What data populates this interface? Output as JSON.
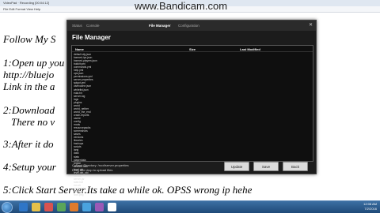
{
  "recorder": {
    "watermark": "www.Bandicam.com"
  },
  "notepad": {
    "title": "VideoPad · Recording [00:04:12]",
    "menu": "File  Edit  Format  View  Help",
    "lines": [
      "Follow My S",
      "1:Open up you",
      "http://bluejo",
      "Link in the a",
      "2:Download",
      "There no v",
      "3:After it do",
      "4:Setup your",
      "5:Click Start Server.Its take a while ok. OPSS wrong ip hehe"
    ]
  },
  "file_manager": {
    "tabs": [
      "Status",
      "Console",
      "File Manager",
      "Configuration"
    ],
    "active_tab": "File Manager",
    "title": "File Manager",
    "columns": {
      "name": "Name",
      "size": "Size",
      "modified": "Last Modified"
    },
    "rows": [
      "default.cfg.json",
      "banned-ips.json",
      "banned-players.json",
      "bukkit.yml",
      "commands.yml",
      "help.yml",
      "ops.json",
      "permissions.yml",
      "server.properties",
      "spigot.yml",
      "usercache.json",
      "whitelist.json",
      "eula.txt",
      "server.log",
      "logs",
      "plugins",
      "world",
      "world_nether",
      "world_the_end",
      "crash-reports",
      "cache",
      "config",
      "mods",
      "resourcepacks",
      "screenshots",
      "saves",
      "versions",
      "libraries",
      "backups",
      "scripts",
      "lang",
      "data",
      "stats",
      "playerdata",
      "region",
      "session.lock",
      "level.dat",
      "level.dat_old",
      "uid.dat",
      "server.jar",
      "start.bat",
      "run.sh",
      "readme.txt",
      "motd.txt",
      "icon.png"
    ],
    "status_line1": "Current Directory: /root/server.properties",
    "status_line2": "Drag and drop to upload files",
    "buttons": {
      "update": "Update",
      "save": "Save",
      "back": "Back"
    }
  },
  "taskbar": {
    "time": "12:08 AM",
    "date": "7/2/2016"
  },
  "colors": {
    "accent": "#1f7fd2",
    "fm_bg": "#1c1c1c",
    "taskbar": "#2a5a8c"
  }
}
